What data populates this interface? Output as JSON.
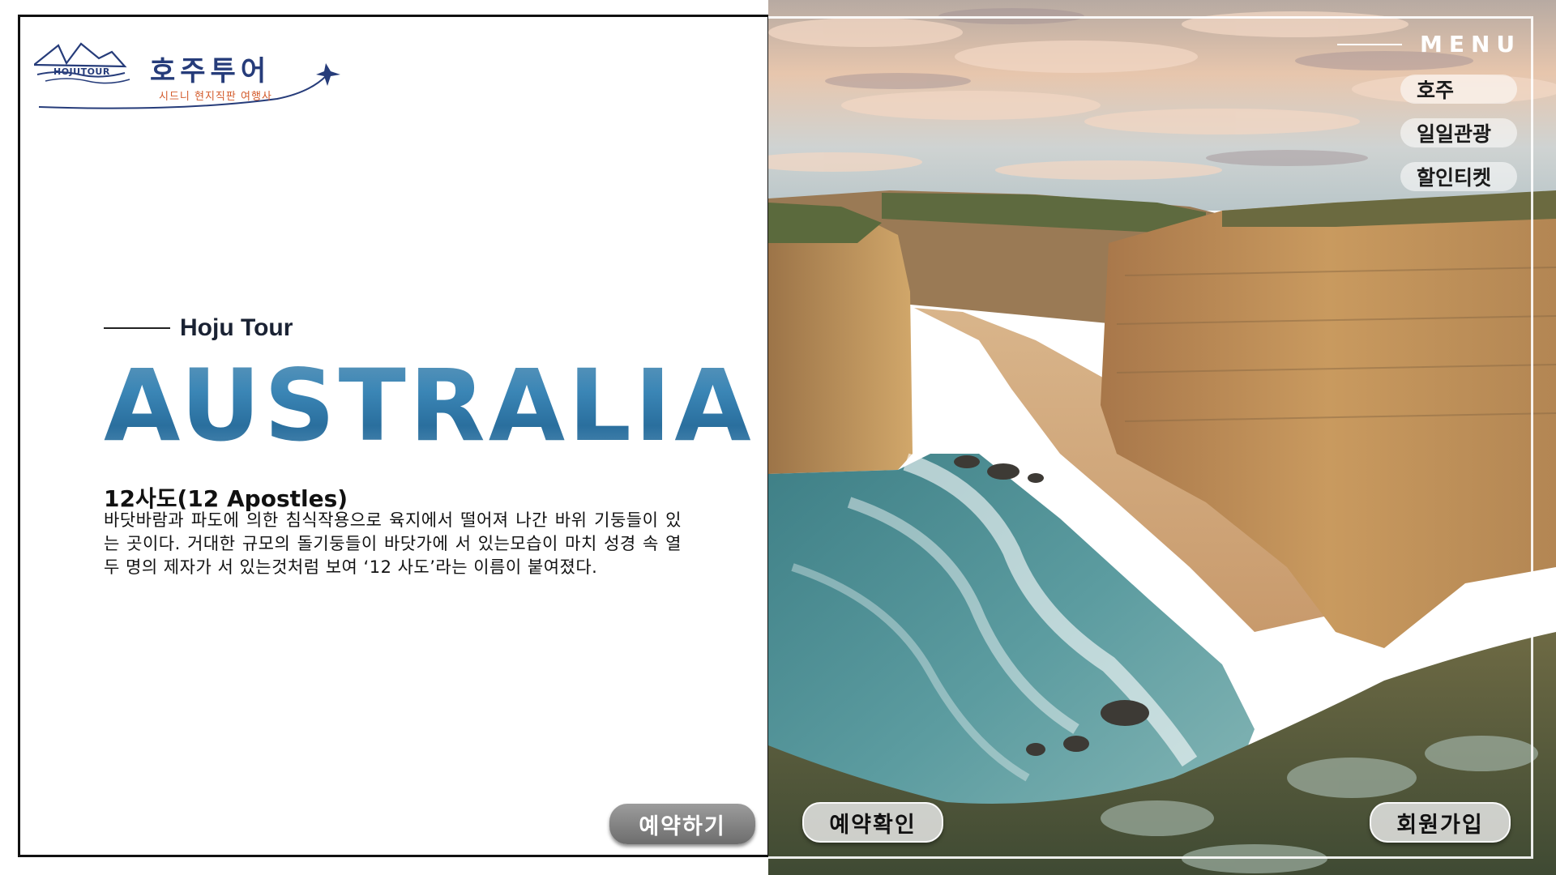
{
  "logo": {
    "name": "호주투어",
    "tagline": "시드니 현지직판 여행사",
    "badge": "HOJUTOUR"
  },
  "hero": {
    "eyebrow": "Hoju Tour",
    "headline": "AUSTRALIA",
    "desc_title": "12사도(12 Apostles)",
    "desc_body": "바닷바람과 파도에 의한 침식작용으로 육지에서 떨어져 나간 바위 기둥들이 있는 곳이다. 거대한 규모의 돌기둥들이 바닷가에 서 있는모습이 마치 성경 속 열두 명의 제자가 서 있는것처럼 보여 ‘12 사도’라는 이름이 붙여졌다."
  },
  "menu": {
    "label": "MENU",
    "items": [
      "호주",
      "일일관광",
      "할인티켓"
    ]
  },
  "buttons": {
    "reserve": "예약하기",
    "check": "예약확인",
    "join": "회원가입"
  },
  "colors": {
    "brand_navy": "#263c7a",
    "brand_orange": "#d35a2a",
    "headline_blue": "#3b86b6"
  }
}
